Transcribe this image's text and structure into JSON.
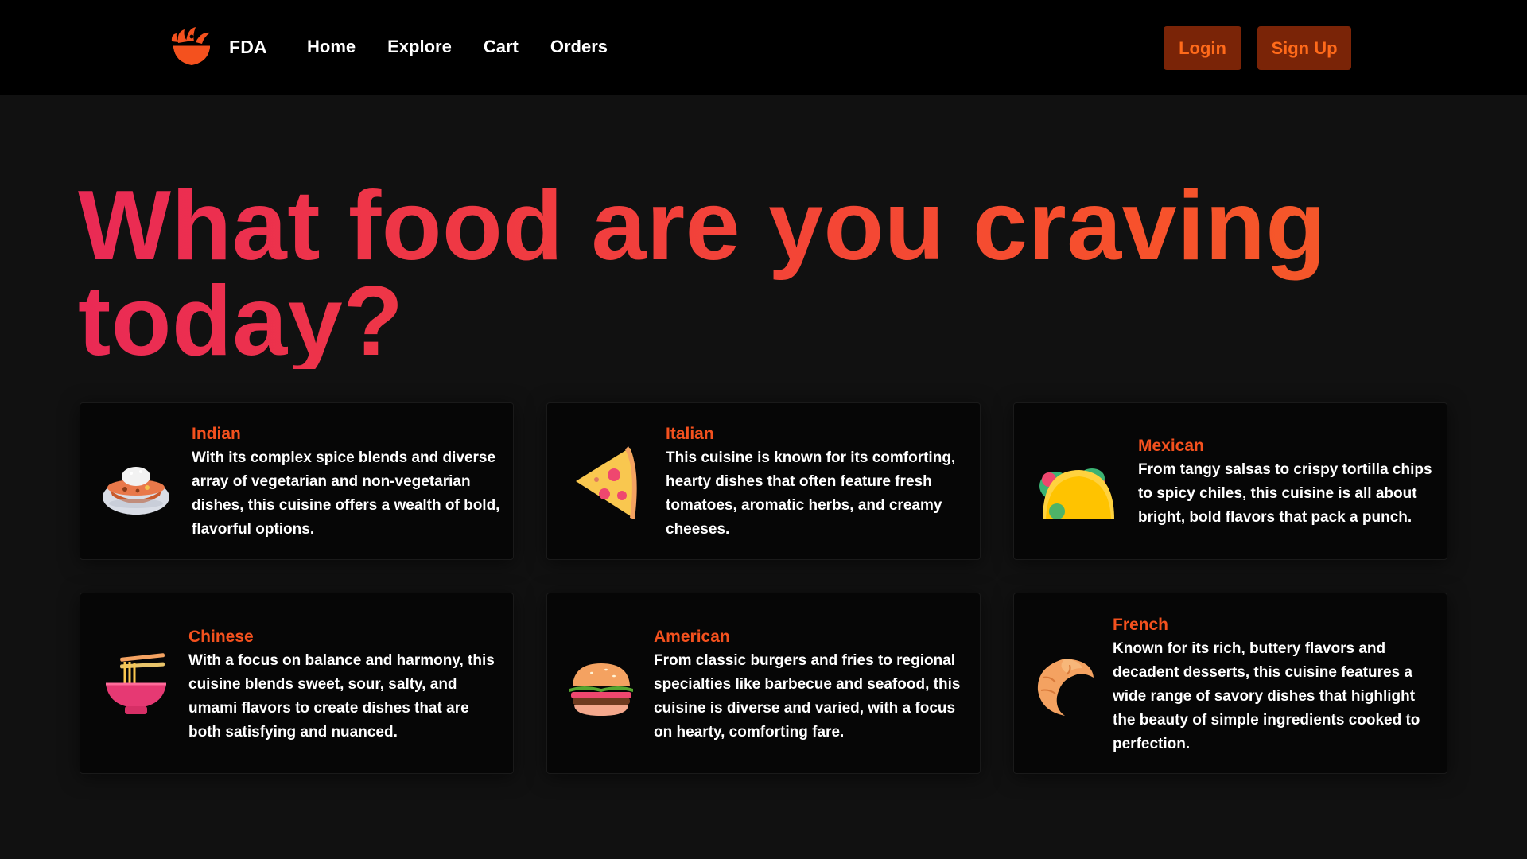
{
  "nav": {
    "brand": "FDA",
    "links": [
      "Home",
      "Explore",
      "Cart",
      "Orders"
    ],
    "login_label": "Login",
    "signup_label": "Sign Up"
  },
  "hero": {
    "title": "What food are you craving today?"
  },
  "cuisines": [
    {
      "name": "Indian",
      "icon": "curry-bowl-icon",
      "description": "With its complex spice blends and diverse array of vegetarian and non-vegetarian dishes, this cuisine offers a wealth of bold, flavorful options."
    },
    {
      "name": "Italian",
      "icon": "pizza-slice-icon",
      "description": "This cuisine is known for its comforting, hearty dishes that often feature fresh tomatoes, aromatic herbs, and creamy cheeses."
    },
    {
      "name": "Mexican",
      "icon": "taco-icon",
      "description": "From tangy salsas to crispy tortilla chips to spicy chiles, this cuisine is all about bright, bold flavors that pack a punch."
    },
    {
      "name": "Chinese",
      "icon": "noodle-bowl-icon",
      "description": "With a focus on balance and harmony, this cuisine blends sweet, sour, salty, and umami flavors to create dishes that are both satisfying and nuanced."
    },
    {
      "name": "American",
      "icon": "burger-icon",
      "description": "From classic burgers and fries to regional specialties like barbecue and seafood, this cuisine is diverse and varied, with a focus on hearty, comforting fare."
    },
    {
      "name": "French",
      "icon": "croissant-icon",
      "description": "Known for its rich, buttery flavors and decadent desserts, this cuisine features a wide range of savory dishes that highlight the beauty of simple ingredients cooked to perfection."
    }
  ],
  "colors": {
    "background": "#111111",
    "navbar": "#000000",
    "card": "#060606",
    "accent": "#f4511e",
    "button_bg": "#7a2407",
    "button_text": "#ff6a1a",
    "title_gradient_start": "#ea2a55",
    "title_gradient_end": "#f25a2a"
  }
}
